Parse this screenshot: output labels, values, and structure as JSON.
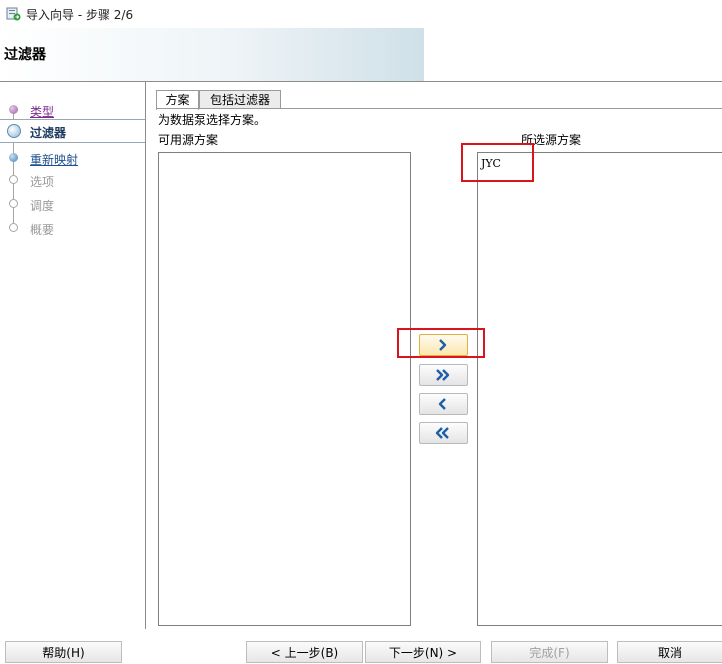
{
  "window": {
    "title": "导入向导 - 步骤 2/6"
  },
  "header": {
    "title": "过滤器"
  },
  "steps": [
    {
      "label": "类型",
      "state": "visited"
    },
    {
      "label": "过滤器",
      "state": "current"
    },
    {
      "label": "重新映射",
      "state": "link"
    },
    {
      "label": "选项",
      "state": "future"
    },
    {
      "label": "调度",
      "state": "future"
    },
    {
      "label": "概要",
      "state": "future"
    }
  ],
  "tabs": [
    {
      "label": "方案",
      "active": true
    },
    {
      "label": "包括过滤器",
      "active": false
    }
  ],
  "panel": {
    "instruction": "为数据泵选择方案。",
    "available_label": "可用源方案",
    "selected_label": "所选源方案",
    "available_items": [],
    "selected_items": [
      "JYC"
    ]
  },
  "move_buttons": [
    {
      "icon": "chevron-right-icon",
      "highlighted": true
    },
    {
      "icon": "double-chevron-right-icon",
      "highlighted": false
    },
    {
      "icon": "chevron-left-icon",
      "highlighted": false
    },
    {
      "icon": "double-chevron-left-icon",
      "highlighted": false
    }
  ],
  "footer": {
    "help": "帮助(H)",
    "back": "< 上一步(B)",
    "next": "下一步(N) >",
    "finish": "完成(F)",
    "cancel": "取消"
  },
  "annotations": {
    "color": "#d9141b"
  }
}
